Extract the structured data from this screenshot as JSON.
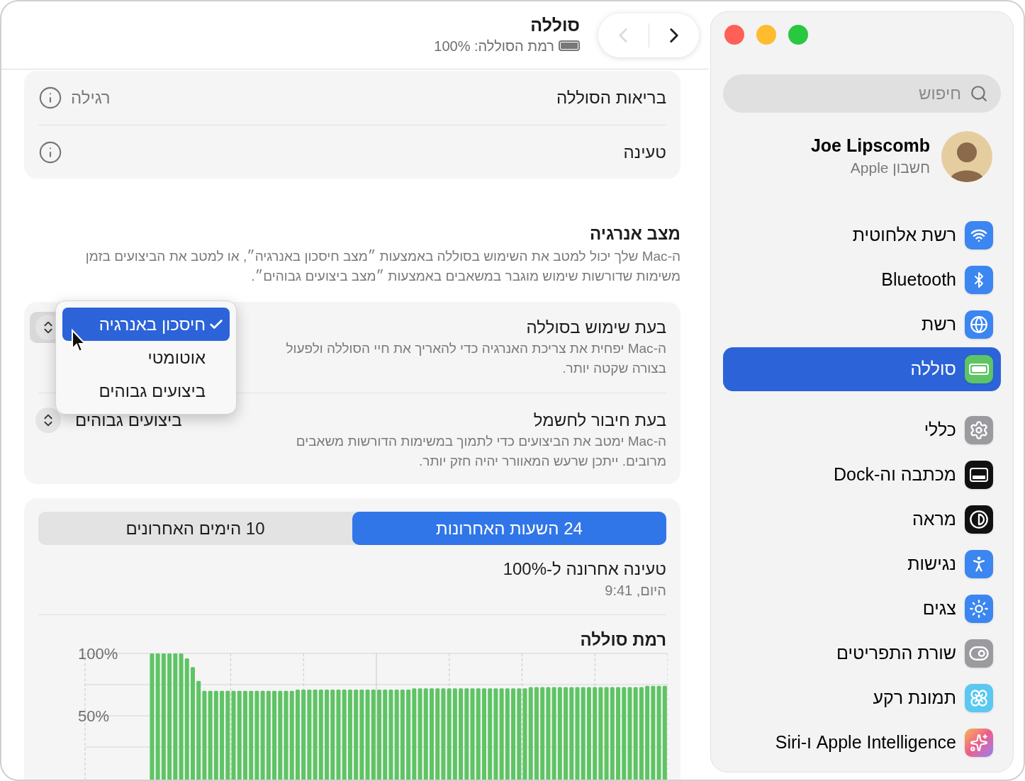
{
  "window": {
    "title": "סוללה",
    "subtitle": "רמת הסוללה: 100%"
  },
  "nav_buttons": [
    {
      "kind": "forward",
      "disabled": false
    },
    {
      "kind": "back",
      "disabled": true
    }
  ],
  "info_rows": [
    {
      "label": "בריאות הסוללה",
      "value": "רגילה"
    },
    {
      "label": "טעינה"
    }
  ],
  "energy_mode": {
    "title": "מצב אנרגיה",
    "description": "ה-Mac שלך יכול למטב את השימוש בסוללה באמצעות ״מצב חיסכון באנרגיה״, או למטב את הביצועים בזמן משימות שדורשות שימוש מוגבר במשאבים באמצעות ״מצב ביצועים גבוהים״.",
    "settings": [
      {
        "label": "בעת שימוש בסוללה",
        "description": "ה-Mac יפחית את צריכת האנרגיה כדי להאריך את חיי הסוללה ולפעול בצורה שקטה יותר.",
        "open": true
      },
      {
        "label": "בעת חיבור לחשמל",
        "description": "ה-Mac ימטב את הביצועים כדי לתמוך במשימות הדורשות משאבים מרובים. ייתכן שרעש המאוורר יהיה חזק יותר.",
        "value": "ביצועים גבוהים",
        "open": false
      }
    ]
  },
  "menu": {
    "items": [
      {
        "label": "חיסכון באנרגיה",
        "checked": true,
        "selected": true
      },
      {
        "label": "אוטומטי",
        "checked": false,
        "selected": false
      },
      {
        "label": "ביצועים גבוהים",
        "checked": false,
        "selected": false
      }
    ]
  },
  "usage": {
    "tabs": [
      {
        "label": "24 השעות האחרונות",
        "selected": true
      },
      {
        "label": "10 הימים האחרונים",
        "selected": false
      }
    ],
    "last_charge": {
      "title": "טעינה אחרונה ל-100%",
      "time": "היום, 9:41"
    },
    "chart_data": {
      "type": "bar",
      "title": "רמת סוללה",
      "grid": true,
      "ylim": [
        0,
        100
      ],
      "yticks": [
        {
          "value": 100,
          "label": "100%"
        },
        {
          "value": 50,
          "label": "50%"
        }
      ],
      "series": [
        {
          "color": "#5ec464",
          "values": [
            null,
            null,
            null,
            null,
            null,
            null,
            null,
            null,
            null,
            null,
            null,
            100,
            100,
            100,
            100,
            100,
            100,
            96,
            89,
            78,
            70,
            70,
            70,
            70,
            70,
            70,
            70,
            70,
            70,
            70,
            70,
            70,
            70,
            70,
            70,
            70,
            71,
            71,
            71,
            71,
            71,
            71,
            71,
            71,
            71,
            71,
            71,
            71,
            71,
            71,
            71,
            71,
            71,
            71,
            71,
            71,
            72,
            72,
            72,
            72,
            72,
            72,
            72,
            72,
            72,
            72,
            72,
            72,
            72,
            72,
            72,
            72,
            72,
            72,
            72,
            72,
            73,
            73,
            73,
            73,
            73,
            73,
            73,
            73,
            73,
            73,
            73,
            73,
            73,
            73,
            73,
            73,
            73,
            73,
            73,
            73,
            74,
            74,
            74,
            74
          ]
        }
      ]
    }
  },
  "sidebar": {
    "search": {
      "placeholder": "חיפוש"
    },
    "account": {
      "name": "Joe Lipscomb",
      "subtitle": "חשבון Apple"
    },
    "groups": [
      [
        {
          "label": "רשת אלחוטית",
          "kind": "wifi",
          "selected": false
        },
        {
          "label": "Bluetooth",
          "kind": "bluetooth",
          "selected": false
        },
        {
          "label": "רשת",
          "kind": "network",
          "selected": false
        },
        {
          "label": "סוללה",
          "kind": "battery",
          "selected": true
        }
      ],
      [
        {
          "label": "כללי",
          "kind": "general",
          "selected": false
        },
        {
          "label": "מכתבה וה-Dock",
          "kind": "dock",
          "selected": false
        },
        {
          "label": "מראה",
          "kind": "appearance",
          "selected": false
        },
        {
          "label": "נגישות",
          "kind": "accessibility",
          "selected": false
        },
        {
          "label": "צגים",
          "kind": "displays",
          "selected": false
        },
        {
          "label": "שורת התפריטים",
          "kind": "menubar",
          "selected": false
        },
        {
          "label": "תמונת רקע",
          "kind": "wallpaper",
          "selected": false
        },
        {
          "label": "Apple Intelligence ו-Siri",
          "kind": "intelligence",
          "selected": false
        }
      ]
    ]
  }
}
